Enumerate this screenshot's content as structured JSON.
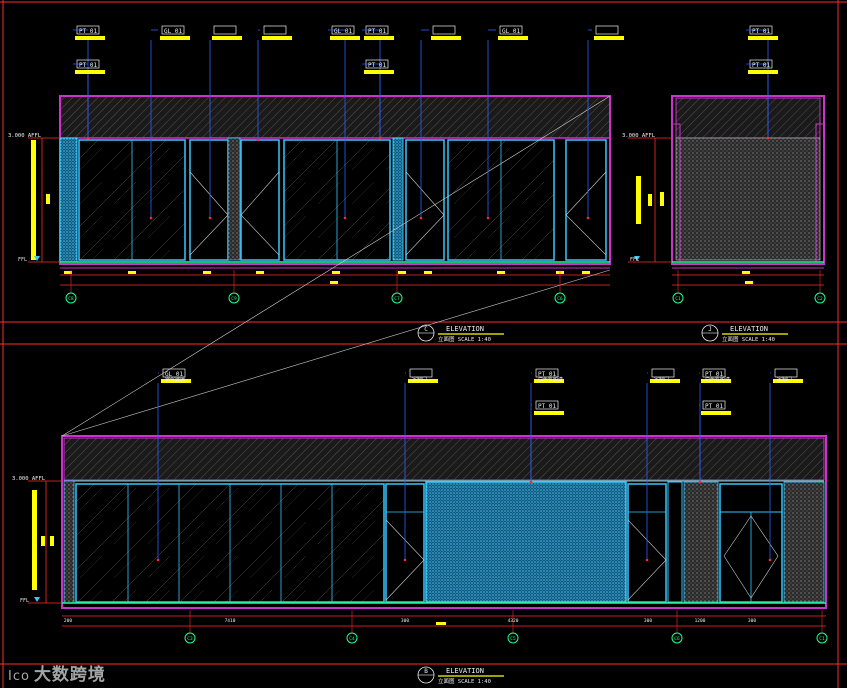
{
  "watermark": {
    "logo": "Ico",
    "text": "大数跨境"
  },
  "colors": {
    "frame_red": "#ff2a2a",
    "wall_magenta": "#cc33cc",
    "glass_cyan": "#36c8ff",
    "tag_blue": "#2f5fff",
    "dim_yellow": "#ffff00",
    "floor_green": "#22ff88"
  },
  "drawings": [
    {
      "id": "C",
      "title": "ELEVATION",
      "subtitle": "立面图 SCALE 1:40",
      "level_label": "3.000 AFFL",
      "floor_label": "FFL",
      "tags": [
        {
          "code": "PT 01"
        },
        {
          "code": "PT 01"
        },
        {
          "code": "GL 01"
        },
        {
          "code": ""
        },
        {
          "code": ""
        },
        {
          "code": "GL 01"
        },
        {
          "code": "PT 01"
        },
        {
          "code": "PT 01"
        },
        {
          "code": ""
        },
        {
          "code": "GL 01"
        },
        {
          "code": ""
        }
      ],
      "grid_markers": [
        "C8",
        "C9",
        "C7",
        "C6"
      ]
    },
    {
      "id": "J",
      "title": "ELEVATION",
      "subtitle": "立面图 SCALE 1:40",
      "level_label": "3.000 AFFL",
      "floor_label": "FFL",
      "tags": [
        {
          "code": "PT 01"
        },
        {
          "code": "PT 01"
        }
      ],
      "grid_markers": [
        "C1",
        "C2"
      ]
    },
    {
      "id": "B",
      "title": "ELEVATION",
      "subtitle": "立面图 SCALE 1:40",
      "level_label": "3.000 AFFL",
      "floor_label": "FFL",
      "tags": [
        {
          "code": "GL 01",
          "note": "钢化玻璃"
        },
        {
          "code": "",
          "note": "定制门"
        },
        {
          "code": "PT 01",
          "note": "白色乳胶漆"
        },
        {
          "code": "PT 01"
        },
        {
          "code": "",
          "note": "定制门"
        },
        {
          "code": "PT 01",
          "note": "白色乳胶漆"
        },
        {
          "code": "PT 01"
        },
        {
          "code": "",
          "note": "定制门"
        }
      ],
      "dimensions": [
        "200",
        "7410",
        "300",
        "4320",
        "300",
        "1200",
        "300"
      ],
      "grid_markers": [
        "C3",
        "C4",
        "C5",
        "C6",
        "C1"
      ]
    }
  ]
}
